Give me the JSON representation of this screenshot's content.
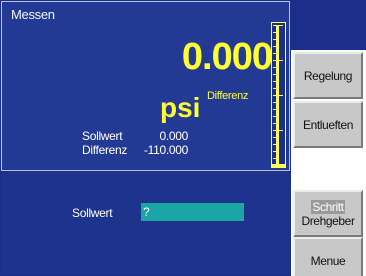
{
  "screen": {
    "title": "Messen",
    "reading": {
      "value": "0.000",
      "unit": "psi",
      "unit_sub": "Differenz"
    },
    "info": [
      {
        "label": "Sollwert",
        "value": "0.000"
      },
      {
        "label": "Differenz",
        "value": "-110.000"
      }
    ],
    "bar_level": 0.02,
    "setpoint": {
      "label": "Sollwert",
      "value": "?"
    }
  },
  "softkeys": {
    "regelung": "Regelung",
    "entlueften": "Entlueften",
    "schritt_top": "Schritt",
    "schritt_bottom": "Drehgeber",
    "menue": "Menue"
  },
  "colors": {
    "screen_bg": "#223a93",
    "reading": "#ffff33",
    "input_bg": "#1aa6a6",
    "softkey_bg": "#c8c8c8"
  }
}
